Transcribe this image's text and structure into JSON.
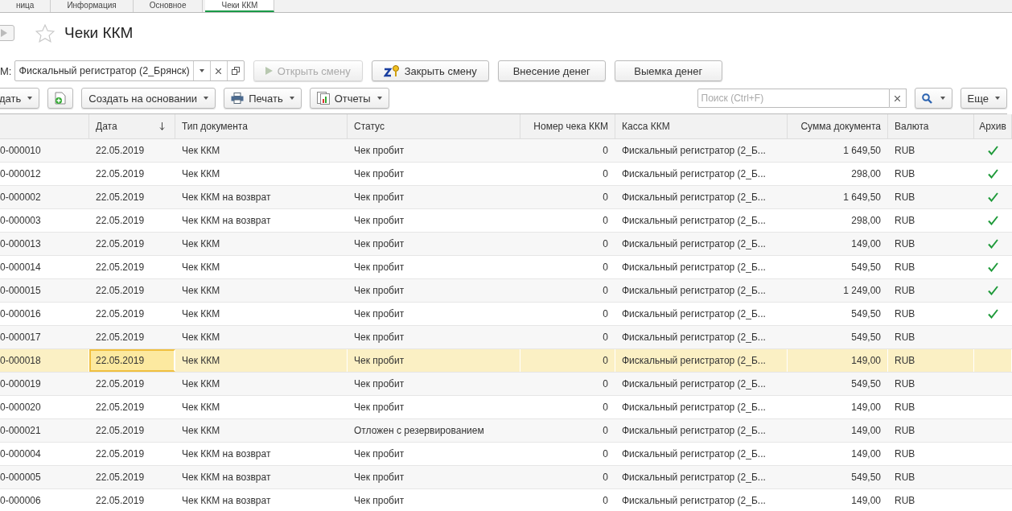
{
  "tabs": [
    {
      "label": "ница",
      "selected": false
    },
    {
      "label": "Информация",
      "selected": false
    },
    {
      "label": "Основное",
      "selected": false
    },
    {
      "label": "Чеки ККМ",
      "selected": true
    }
  ],
  "title": "Чеки ККМ",
  "favorite": false,
  "filter": {
    "label": "М:",
    "value": "Фискальный регистратор (2_Брянск)"
  },
  "action_buttons": [
    {
      "label": "Открыть смену",
      "disabled": true
    },
    {
      "label": "Закрыть смену",
      "disabled": false
    },
    {
      "label": "Внесение денег",
      "disabled": false
    },
    {
      "label": "Выемка денег",
      "disabled": false
    }
  ],
  "toolbar": [
    {
      "kind": "text",
      "label": "дать"
    },
    {
      "kind": "icon"
    },
    {
      "kind": "text",
      "label": "Создать на основании"
    },
    {
      "kind": "text",
      "label": "Печать"
    },
    {
      "kind": "text",
      "label": "Отчеты"
    }
  ],
  "search": {
    "placeholder": "Поиск (Ctrl+F)"
  },
  "more_button": "Еще",
  "table": {
    "columns": [
      {
        "sorted": false
      },
      {
        "label": "Дата",
        "sorted": true
      },
      {
        "label": "Тип документа",
        "sorted": false
      },
      {
        "label": "Статус",
        "sorted": false
      },
      {
        "label": "Номер чека ККМ",
        "sorted": false
      },
      {
        "label": "Касса ККМ",
        "sorted": false
      },
      {
        "label": "Сумма документа",
        "sorted": false
      },
      {
        "label": "Валюта",
        "sorted": false
      },
      {
        "label": "Архив",
        "sorted": false
      }
    ],
    "rows": [
      {
        "cells": [
          "0-000010",
          "22.05.2019",
          "Чек ККМ",
          "Чек пробит",
          "0",
          "Фискальный регистратор (2_Б...",
          "1 649,50",
          "RUB"
        ],
        "archived": true,
        "selected": false
      },
      {
        "cells": [
          "0-000012",
          "22.05.2019",
          "Чек ККМ",
          "Чек пробит",
          "0",
          "Фискальный регистратор (2_Б...",
          "298,00",
          "RUB"
        ],
        "archived": true,
        "selected": false
      },
      {
        "cells": [
          "0-000002",
          "22.05.2019",
          "Чек ККМ на возврат",
          "Чек пробит",
          "0",
          "Фискальный регистратор (2_Б...",
          "1 649,50",
          "RUB"
        ],
        "archived": true,
        "selected": false
      },
      {
        "cells": [
          "0-000003",
          "22.05.2019",
          "Чек ККМ на возврат",
          "Чек пробит",
          "0",
          "Фискальный регистратор (2_Б...",
          "298,00",
          "RUB"
        ],
        "archived": true,
        "selected": false
      },
      {
        "cells": [
          "0-000013",
          "22.05.2019",
          "Чек ККМ",
          "Чек пробит",
          "0",
          "Фискальный регистратор (2_Б...",
          "149,00",
          "RUB"
        ],
        "archived": true,
        "selected": false
      },
      {
        "cells": [
          "0-000014",
          "22.05.2019",
          "Чек ККМ",
          "Чек пробит",
          "0",
          "Фискальный регистратор (2_Б...",
          "549,50",
          "RUB"
        ],
        "archived": true,
        "selected": false
      },
      {
        "cells": [
          "0-000015",
          "22.05.2019",
          "Чек ККМ",
          "Чек пробит",
          "0",
          "Фискальный регистратор (2_Б...",
          "1 249,00",
          "RUB"
        ],
        "archived": true,
        "selected": false
      },
      {
        "cells": [
          "0-000016",
          "22.05.2019",
          "Чек ККМ",
          "Чек пробит",
          "0",
          "Фискальный регистратор (2_Б...",
          "549,50",
          "RUB"
        ],
        "archived": true,
        "selected": false
      },
      {
        "cells": [
          "0-000017",
          "22.05.2019",
          "Чек ККМ",
          "Чек пробит",
          "0",
          "Фискальный регистратор (2_Б...",
          "549,50",
          "RUB"
        ],
        "archived": false,
        "selected": false
      },
      {
        "cells": [
          "0-000018",
          "22.05.2019",
          "Чек ККМ",
          "Чек пробит",
          "0",
          "Фискальный регистратор (2_Б...",
          "149,00",
          "RUB"
        ],
        "archived": false,
        "selected": true
      },
      {
        "cells": [
          "0-000019",
          "22.05.2019",
          "Чек ККМ",
          "Чек пробит",
          "0",
          "Фискальный регистратор (2_Б...",
          "549,50",
          "RUB"
        ],
        "archived": false,
        "selected": false
      },
      {
        "cells": [
          "0-000020",
          "22.05.2019",
          "Чек ККМ",
          "Чек пробит",
          "0",
          "Фискальный регистратор (2_Б...",
          "149,00",
          "RUB"
        ],
        "archived": false,
        "selected": false
      },
      {
        "cells": [
          "0-000021",
          "22.05.2019",
          "Чек ККМ",
          "Отложен с резервированием",
          "0",
          "Фискальный регистратор (2_Б...",
          "149,00",
          "RUB"
        ],
        "archived": false,
        "selected": false
      },
      {
        "cells": [
          "0-000004",
          "22.05.2019",
          "Чек ККМ на возврат",
          "Чек пробит",
          "0",
          "Фискальный регистратор (2_Б...",
          "149,00",
          "RUB"
        ],
        "archived": false,
        "selected": false
      },
      {
        "cells": [
          "0-000005",
          "22.05.2019",
          "Чек ККМ на возврат",
          "Чек пробит",
          "0",
          "Фискальный регистратор (2_Б...",
          "549,50",
          "RUB"
        ],
        "archived": false,
        "selected": false
      },
      {
        "cells": [
          "0-000006",
          "22.05.2019",
          "Чек ККМ на возврат",
          "Чек пробит",
          "0",
          "Фискальный регистратор (2_Б...",
          "149,00",
          "RUB"
        ],
        "archived": false,
        "selected": false
      }
    ]
  }
}
